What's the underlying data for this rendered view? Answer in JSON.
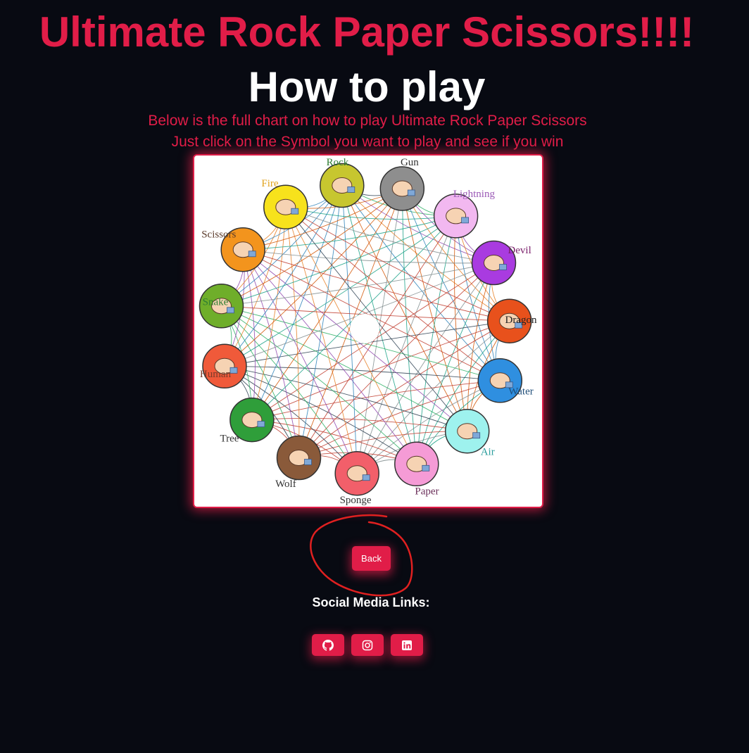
{
  "header": {
    "title": "Ultimate Rock Paper Scissors!!!!",
    "subtitle": "How to play",
    "description_line1": "Below is the full chart on how to play Ultimate Rock Paper Scissors",
    "description_line2": "Just click on the Symbol you want to play and see if you win"
  },
  "chart": {
    "symbols": [
      {
        "label": "Rock",
        "color": "#c7c62f",
        "label_color": "#2e7d32"
      },
      {
        "label": "Gun",
        "color": "#8e8e8e",
        "label_color": "#333333"
      },
      {
        "label": "Lightning",
        "color": "#f2b8f0",
        "label_color": "#9b59b6"
      },
      {
        "label": "Devil",
        "color": "#a93be0",
        "label_color": "#7a1f6b"
      },
      {
        "label": "Dragon",
        "color": "#e8511c",
        "label_color": "#222222"
      },
      {
        "label": "Water",
        "color": "#2f8fe0",
        "label_color": "#1f4e79"
      },
      {
        "label": "Air",
        "color": "#9ef2ee",
        "label_color": "#2a9d9d"
      },
      {
        "label": "Paper",
        "color": "#f59bd6",
        "label_color": "#6b2f5a"
      },
      {
        "label": "Sponge",
        "color": "#f25f6a",
        "label_color": "#333333"
      },
      {
        "label": "Wolf",
        "color": "#8a5a3a",
        "label_color": "#333333"
      },
      {
        "label": "Tree",
        "color": "#2f9e3a",
        "label_color": "#333333"
      },
      {
        "label": "Human",
        "color": "#f05a3a",
        "label_color": "#7a3b2a"
      },
      {
        "label": "Snake",
        "color": "#6fae2a",
        "label_color": "#2e7d32"
      },
      {
        "label": "Scissors",
        "color": "#f3941d",
        "label_color": "#5a3a2a"
      },
      {
        "label": "Fire",
        "color": "#f7e21c",
        "label_color": "#e1a21c"
      }
    ],
    "line_colors": [
      "#c0392b",
      "#2c3e50",
      "#27ae60",
      "#8e44ad",
      "#e67e22",
      "#2980b9",
      "#d35400",
      "#16a085",
      "#7f8c8d",
      "#c0392b"
    ]
  },
  "back_button": {
    "label": "Back"
  },
  "social": {
    "heading": "Social Media Links:",
    "links": [
      {
        "icon": "github-icon"
      },
      {
        "icon": "instagram-icon"
      },
      {
        "icon": "linkedin-icon"
      }
    ]
  },
  "colors": {
    "accent": "#e11d48",
    "background": "#080a12"
  }
}
